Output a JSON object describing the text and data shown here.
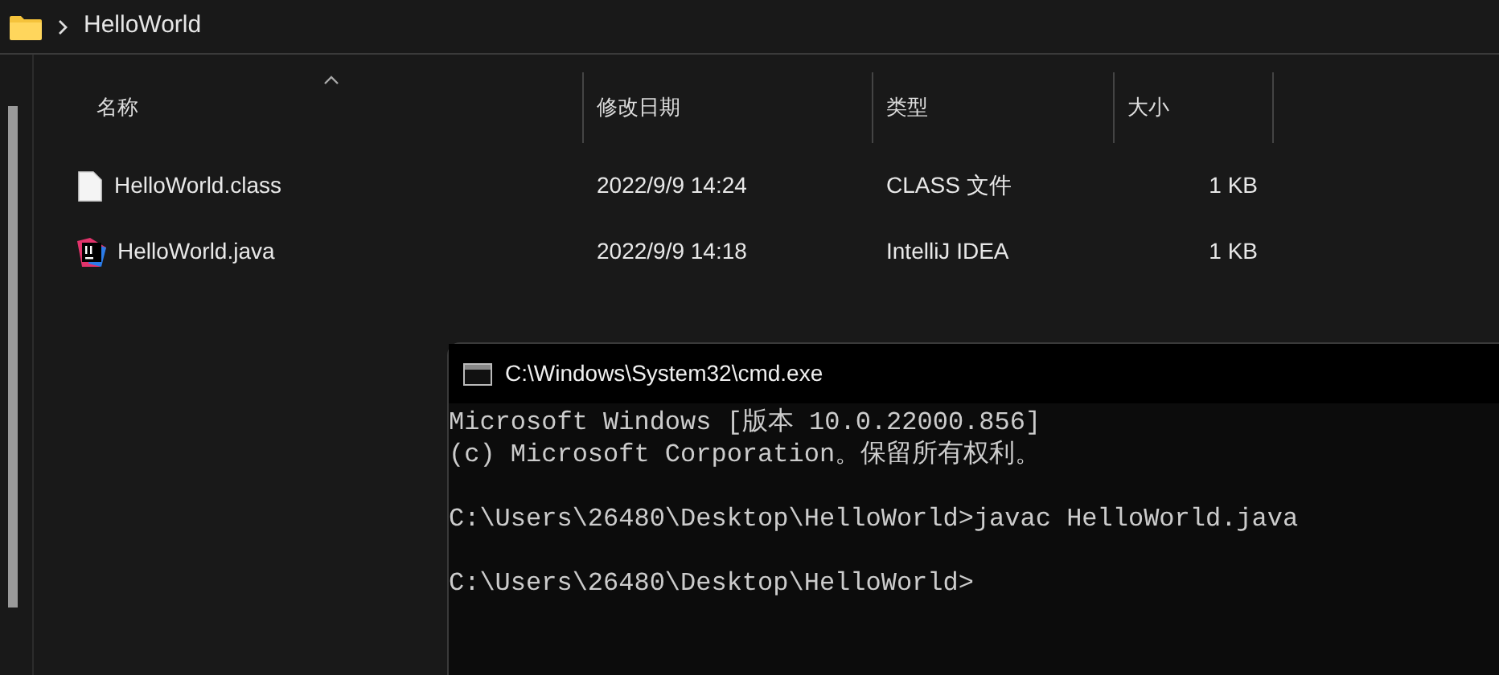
{
  "breadcrumb": {
    "items": [
      "HelloWorld"
    ]
  },
  "table": {
    "columns": [
      {
        "label": "名称",
        "sorted": true
      },
      {
        "label": "修改日期",
        "sorted": false
      },
      {
        "label": "类型",
        "sorted": false
      },
      {
        "label": "大小",
        "sorted": false
      }
    ],
    "rows": [
      {
        "kind": "class",
        "name": "HelloWorld.class",
        "modified": "2022/9/9 14:24",
        "type": "CLASS 文件",
        "size": "1 KB"
      },
      {
        "kind": "java",
        "name": "HelloWorld.java",
        "modified": "2022/9/9 14:18",
        "type": "IntelliJ IDEA",
        "size": "1 KB"
      }
    ]
  },
  "terminal": {
    "title": "C:\\Windows\\System32\\cmd.exe",
    "paragraphs": [
      [
        "Microsoft Windows [版本 10.0.22000.856]",
        "(c) Microsoft Corporation。保留所有权利。"
      ],
      [
        "C:\\Users\\26480\\Desktop\\HelloWorld>javac HelloWorld.java"
      ],
      [
        "C:\\Users\\26480\\Desktop\\HelloWorld>"
      ]
    ]
  }
}
